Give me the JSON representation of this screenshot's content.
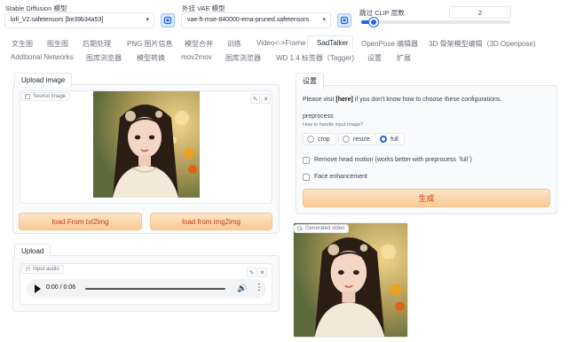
{
  "header": {
    "sd_model_label": "Stable Diffusion 模型",
    "sd_model_value": "lofi_V2.safetensors [be39b34a53]",
    "vae_label": "外挂 VAE 模型",
    "vae_value": "vae-ft-mse-840000-ema-pruned.safetensors",
    "clip_label": "跳过 CLIP 层数",
    "clip_value": "2",
    "clip_fraction": 0.083
  },
  "tabs_row1": [
    "文生图",
    "图生图",
    "后期处理",
    "PNG 图片信息",
    "模型合并",
    "训练",
    "Video<->Frame",
    "SadTalker",
    "OpenPose 编辑器",
    "3D 骨架模型编辑（3D Openpose)"
  ],
  "tabs_row2": [
    "Additional Networks",
    "图库浏览器",
    "模型转换",
    "mov2mov",
    "图库浏览器",
    "WD 1.4 标签器（Tagger)",
    "设置",
    "扩展"
  ],
  "active_tab": "SadTalker",
  "left": {
    "upload_image_tab": "Upload image",
    "source_image_label": "Source image",
    "btn_txt2img": "load From txt2img",
    "btn_img2img": "load from img2img",
    "upload_tab": "Upload",
    "input_audio_label": "Input audio",
    "audio_time": "0:00 / 0:06"
  },
  "right": {
    "settings_tab": "设置",
    "help_prefix": "Please visit ",
    "help_link": "[here]",
    "help_suffix": " if you don't know how to choose these configurations.",
    "preprocess_label": "preprocess",
    "preprocess_hint": "How to handle input image?",
    "options": [
      "crop",
      "resize",
      "full"
    ],
    "selected_option": "full",
    "remove_head_motion": "Remove head motion (works better with preprocess `full`)",
    "face_enhancement": "Face enhancement",
    "generate_button": "生成",
    "generated_video_label": "Generated video"
  },
  "colors": {
    "accent": "#2563eb",
    "orange": "#ea580c",
    "orange_bg": "#fbd5a5"
  }
}
